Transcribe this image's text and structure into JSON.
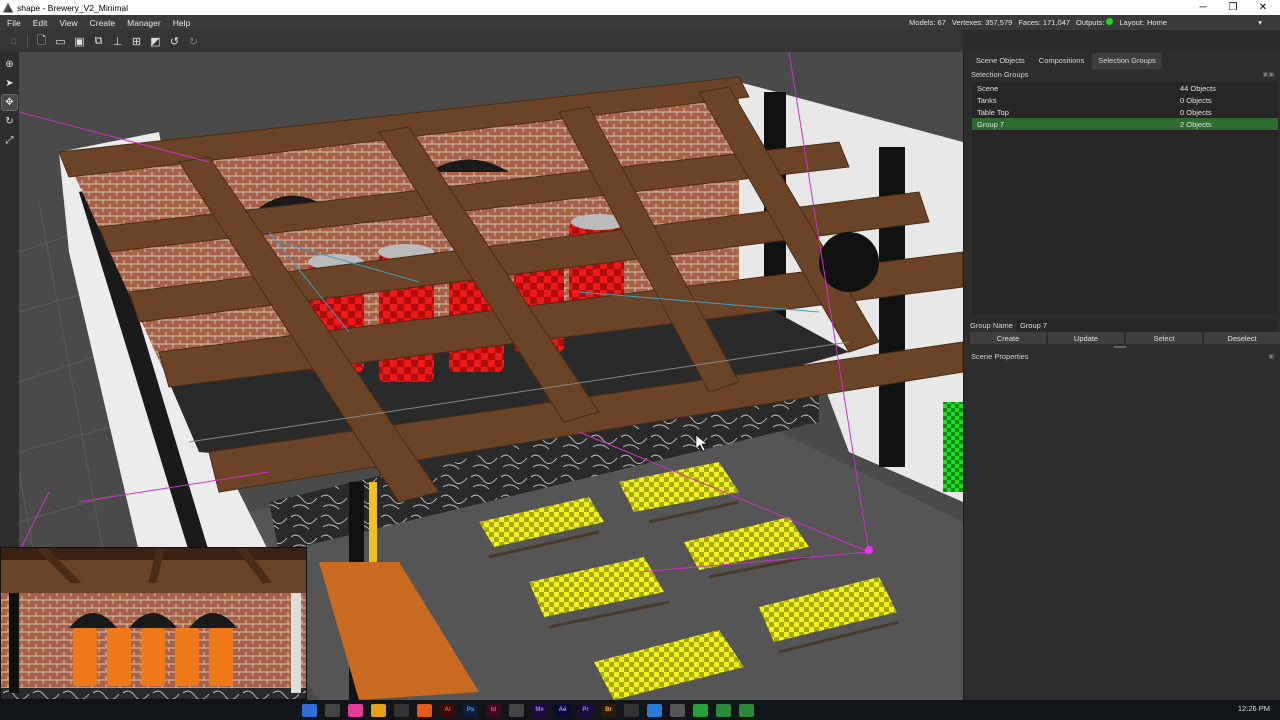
{
  "window": {
    "title": "shape - Brewery_V2_Minimal",
    "minimize": "─",
    "restore": "❐",
    "close": "✕"
  },
  "menu": [
    "File",
    "Edit",
    "View",
    "Create",
    "Manager",
    "Help"
  ],
  "stats": {
    "models": "Models: 67",
    "vertexes": "Vertexes: 357,579",
    "faces": "Faces: 171,047",
    "outputs": "Outputs:",
    "outputs_status_color": "#22d822",
    "layout_label": "Layout:",
    "layout_value": "Home"
  },
  "toolbar": [
    "home-icon",
    "new-file-icon",
    "open-folder-icon",
    "save-icon",
    "save-all-icon",
    "hierarchy-icon",
    "group-icon",
    "ungroup-icon",
    "undo-icon",
    "redo-icon"
  ],
  "tools": [
    "globe-icon",
    "select-arrow-icon",
    "move-icon",
    "rotate-icon",
    "scale-icon"
  ],
  "panel": {
    "tabs": [
      "Scene Objects",
      "Compositions",
      "Selection Groups"
    ],
    "active_tab": "Selection Groups",
    "section_title": "Selection Groups",
    "groups": [
      {
        "name": "Scene",
        "count": "44 Objects"
      },
      {
        "name": "Tanks",
        "count": "0 Objects"
      },
      {
        "name": "Table Top",
        "count": "0 Objects"
      },
      {
        "name": "Group 7",
        "count": "2 Objects"
      }
    ],
    "selected_group": "Group 7",
    "group_name_label": "Group Name",
    "group_name_value": "Group 7",
    "buttons": {
      "create": "Create",
      "update": "Update",
      "select": "Select",
      "deselect": "Deselect"
    },
    "scene_properties_title": "Scene Properties"
  },
  "taskbar": {
    "clock": "12:26 PM"
  },
  "colors": {
    "selection_green": "#2e6b2e",
    "beam_brown": "#6b4326",
    "brick": "#a0604a",
    "tank_red": "#e01818",
    "checker_yellow": "#f0f020",
    "guide_magenta": "#cc33cc"
  }
}
